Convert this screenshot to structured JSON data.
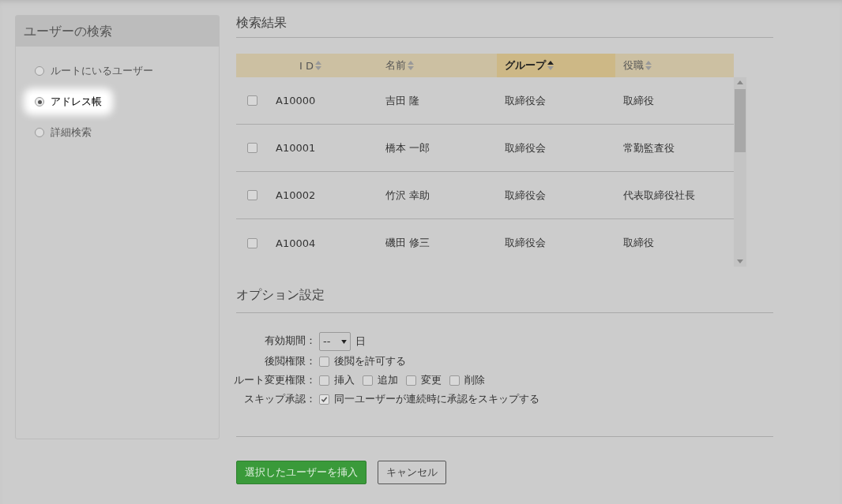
{
  "sidebar": {
    "title": "ユーザーの検索",
    "options": [
      {
        "label": "ルートにいるユーザー",
        "selected": false
      },
      {
        "label": "アドレス帳",
        "selected": true
      },
      {
        "label": "詳細検索",
        "selected": false
      }
    ]
  },
  "results": {
    "title": "検索結果",
    "columns": [
      {
        "label": "I D",
        "sorted": false
      },
      {
        "label": "名前",
        "sorted": false
      },
      {
        "label": "グループ",
        "sorted": true
      },
      {
        "label": "役職",
        "sorted": false
      }
    ],
    "rows": [
      {
        "checked": false,
        "cells": [
          "A10000",
          "吉田 隆",
          "取締役会",
          "取締役"
        ]
      },
      {
        "checked": false,
        "cells": [
          "A10001",
          "橋本 一郎",
          "取締役会",
          "常勤監査役"
        ]
      },
      {
        "checked": false,
        "cells": [
          "A10002",
          "竹沢 幸助",
          "取締役会",
          "代表取締役社長"
        ]
      },
      {
        "checked": false,
        "cells": [
          "A10004",
          "磯田 修三",
          "取締役会",
          "取締役"
        ]
      }
    ]
  },
  "options": {
    "title": "オプション設定",
    "rows": [
      {
        "kind": "select",
        "label": "有効期間：",
        "value": "--",
        "unit": "日"
      },
      {
        "kind": "checks",
        "label": "後閲権限：",
        "items": [
          {
            "label": "後閲を許可する",
            "checked": false
          }
        ]
      },
      {
        "kind": "checks",
        "label": "ルート変更権限：",
        "items": [
          {
            "label": "挿入",
            "checked": false
          },
          {
            "label": "追加",
            "checked": false
          },
          {
            "label": "変更",
            "checked": false
          },
          {
            "label": "削除",
            "checked": false
          }
        ]
      },
      {
        "kind": "checks",
        "label": "スキップ承認：",
        "items": [
          {
            "label": "同一ユーザーが連続時に承認をスキップする",
            "checked": true
          }
        ]
      }
    ]
  },
  "buttons": {
    "primary": "選択したユーザーを挿入",
    "secondary": "キャンセル"
  }
}
